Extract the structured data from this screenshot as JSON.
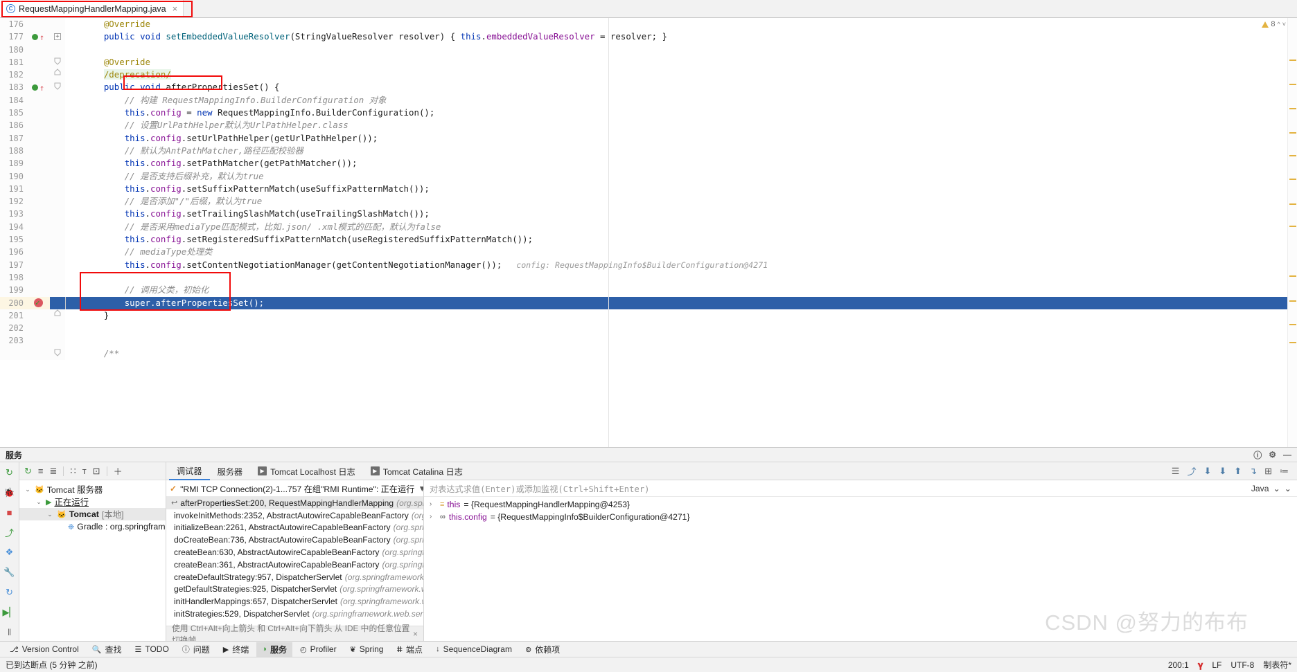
{
  "editor_tab": {
    "filename": "RequestMappingHandlerMapping.java",
    "icon": "java-class-icon",
    "close": "×"
  },
  "inspections": {
    "warning_count": "8",
    "warning_icon": "warning-triangle-icon",
    "chevron": "∧"
  },
  "code": {
    "lines": [
      {
        "num": "176",
        "segments": [
          {
            "t": "    ",
            "c": "id"
          },
          {
            "t": "@Override",
            "c": "ann"
          }
        ]
      },
      {
        "num": "177",
        "segments": [
          {
            "t": "    ",
            "c": "id"
          },
          {
            "t": "public",
            "c": "kw"
          },
          {
            "t": " ",
            "c": "id"
          },
          {
            "t": "void",
            "c": "kw"
          },
          {
            "t": " ",
            "c": "id"
          },
          {
            "t": "setEmbeddedValueResolver",
            "c": "mth-blue"
          },
          {
            "t": "(StringValueResolver resolver) { ",
            "c": "id"
          },
          {
            "t": "this",
            "c": "kw"
          },
          {
            "t": ".",
            "c": "id"
          },
          {
            "t": "embeddedValueResolver",
            "c": "fld"
          },
          {
            "t": " = resolver; }",
            "c": "id"
          }
        ],
        "marker": "override-green",
        "fold": "plus"
      },
      {
        "num": "180",
        "segments": []
      },
      {
        "num": "181",
        "segments": [
          {
            "t": "    ",
            "c": "id"
          },
          {
            "t": "@Override",
            "c": "ann"
          }
        ],
        "fold": "fold-top"
      },
      {
        "num": "182",
        "segments": [
          {
            "t": "    ",
            "c": "id"
          },
          {
            "t": "/deprecation/",
            "c": "ann depr"
          }
        ],
        "fold": "fold-bot"
      },
      {
        "num": "183",
        "segments": [
          {
            "t": "    ",
            "c": "id"
          },
          {
            "t": "public",
            "c": "kw"
          },
          {
            "t": " ",
            "c": "id"
          },
          {
            "t": "void",
            "c": "kw"
          },
          {
            "t": " ",
            "c": "id"
          },
          {
            "t": "afterPropertiesSet",
            "c": "id"
          },
          {
            "t": "() {",
            "c": "id"
          }
        ],
        "marker": "override-green",
        "fold": "fold-top"
      },
      {
        "num": "184",
        "segments": [
          {
            "t": "        ",
            "c": "id"
          },
          {
            "t": "// 构建 RequestMappingInfo.BuilderConfiguration 对象",
            "c": "cmt"
          }
        ]
      },
      {
        "num": "185",
        "segments": [
          {
            "t": "        ",
            "c": "id"
          },
          {
            "t": "this",
            "c": "kw"
          },
          {
            "t": ".",
            "c": "id"
          },
          {
            "t": "config",
            "c": "fld"
          },
          {
            "t": " = ",
            "c": "id"
          },
          {
            "t": "new",
            "c": "kw"
          },
          {
            "t": " RequestMappingInfo.BuilderConfiguration();",
            "c": "id"
          }
        ]
      },
      {
        "num": "186",
        "segments": [
          {
            "t": "        ",
            "c": "id"
          },
          {
            "t": "// 设置UrlPathHelper默认为UrlPathHelper.class",
            "c": "cmt"
          }
        ]
      },
      {
        "num": "187",
        "segments": [
          {
            "t": "        ",
            "c": "id"
          },
          {
            "t": "this",
            "c": "kw"
          },
          {
            "t": ".",
            "c": "id"
          },
          {
            "t": "config",
            "c": "fld"
          },
          {
            "t": ".setUrlPathHelper(getUrlPathHelper());",
            "c": "id"
          }
        ]
      },
      {
        "num": "188",
        "segments": [
          {
            "t": "        ",
            "c": "id"
          },
          {
            "t": "// 默认为AntPathMatcher,路径匹配校验器",
            "c": "cmt"
          }
        ]
      },
      {
        "num": "189",
        "segments": [
          {
            "t": "        ",
            "c": "id"
          },
          {
            "t": "this",
            "c": "kw"
          },
          {
            "t": ".",
            "c": "id"
          },
          {
            "t": "config",
            "c": "fld"
          },
          {
            "t": ".setPathMatcher(getPathMatcher());",
            "c": "id"
          }
        ]
      },
      {
        "num": "190",
        "segments": [
          {
            "t": "        ",
            "c": "id"
          },
          {
            "t": "// 是否支持后缀补充，默认为true",
            "c": "cmt"
          }
        ]
      },
      {
        "num": "191",
        "segments": [
          {
            "t": "        ",
            "c": "id"
          },
          {
            "t": "this",
            "c": "kw"
          },
          {
            "t": ".",
            "c": "id"
          },
          {
            "t": "config",
            "c": "fld"
          },
          {
            "t": ".setSuffixPatternMatch(useSuffixPatternMatch());",
            "c": "id"
          }
        ]
      },
      {
        "num": "192",
        "segments": [
          {
            "t": "        ",
            "c": "id"
          },
          {
            "t": "// 是否添加\"/\"后缀，默认为true",
            "c": "cmt"
          }
        ]
      },
      {
        "num": "193",
        "segments": [
          {
            "t": "        ",
            "c": "id"
          },
          {
            "t": "this",
            "c": "kw"
          },
          {
            "t": ".",
            "c": "id"
          },
          {
            "t": "config",
            "c": "fld"
          },
          {
            "t": ".setTrailingSlashMatch(useTrailingSlashMatch());",
            "c": "id"
          }
        ]
      },
      {
        "num": "194",
        "segments": [
          {
            "t": "        ",
            "c": "id"
          },
          {
            "t": "// 是否采用mediaType匹配模式，比如.json/ .xml模式的匹配，默认为false",
            "c": "cmt"
          }
        ]
      },
      {
        "num": "195",
        "segments": [
          {
            "t": "        ",
            "c": "id"
          },
          {
            "t": "this",
            "c": "kw"
          },
          {
            "t": ".",
            "c": "id"
          },
          {
            "t": "config",
            "c": "fld"
          },
          {
            "t": ".setRegisteredSuffixPatternMatch(useRegisteredSuffixPatternMatch());",
            "c": "id"
          }
        ]
      },
      {
        "num": "196",
        "segments": [
          {
            "t": "        ",
            "c": "id"
          },
          {
            "t": "// mediaType处理类",
            "c": "cmt"
          }
        ]
      },
      {
        "num": "197",
        "segments": [
          {
            "t": "        ",
            "c": "id"
          },
          {
            "t": "this",
            "c": "kw"
          },
          {
            "t": ".",
            "c": "id"
          },
          {
            "t": "config",
            "c": "fld"
          },
          {
            "t": ".setContentNegotiationManager(getContentNegotiationManager());",
            "c": "id"
          },
          {
            "t": "   config: RequestMappingInfo$BuilderConfiguration@4271",
            "c": "hint"
          }
        ]
      },
      {
        "num": "198",
        "segments": []
      },
      {
        "num": "199",
        "segments": [
          {
            "t": "        ",
            "c": "id"
          },
          {
            "t": "// 调用父类，初始化",
            "c": "cmt"
          }
        ]
      },
      {
        "num": "200",
        "segments": [
          {
            "t": "        ",
            "c": "id"
          },
          {
            "t": "super",
            "c": "kw"
          },
          {
            "t": ".afterPropertiesSet();",
            "c": "id"
          }
        ],
        "highlight": true,
        "marker": "breakpoint-hit"
      },
      {
        "num": "201",
        "segments": [
          {
            "t": "    ",
            "c": "id"
          },
          {
            "t": "}",
            "c": "id"
          }
        ],
        "fold": "fold-bot"
      },
      {
        "num": "202",
        "segments": []
      },
      {
        "num": "203",
        "segments": []
      },
      {
        "num": "",
        "segments": [
          {
            "t": "    ",
            "c": "id"
          },
          {
            "t": "/**",
            "c": "cmt"
          }
        ],
        "fold": "fold-top"
      }
    ],
    "annotation_boxes": [
      {
        "name": "method-name-redbox"
      },
      {
        "name": "super-call-redbox"
      }
    ]
  },
  "services_panel": {
    "title": "服务",
    "settings_icon": "gear-icon",
    "help_icon": "help-icon",
    "minimize_icon": "minimize-icon",
    "left_rail": [
      {
        "name": "rerun-icon",
        "glyph": "↻",
        "color": "#3c9a3c"
      },
      {
        "name": "debug-icon",
        "glyph": "🐞",
        "color": "#3c9a3c"
      },
      {
        "name": "stop-icon",
        "glyph": "■",
        "color": "#d64949"
      },
      {
        "name": "deploy-icon",
        "glyph": "⤴",
        "color": "#3c9a3c"
      },
      {
        "name": "browse-icon",
        "glyph": "❖",
        "color": "#4a90d9"
      },
      {
        "name": "settings-icon",
        "glyph": "🔧",
        "color": "#5a5a5a"
      },
      {
        "name": "restart-icon",
        "glyph": "↻",
        "color": "#4a90d9"
      },
      {
        "name": "resume-icon",
        "glyph": "▶▏",
        "color": "#3c9a3c"
      },
      {
        "name": "pause-icon",
        "glyph": "‖",
        "color": "#6a6a6a"
      },
      {
        "name": "more-icon",
        "glyph": "»",
        "color": "#6a6a6a"
      }
    ],
    "tree_toolbar": [
      {
        "name": "refresh-icon",
        "glyph": "↻",
        "color": "#3c9a3c"
      },
      {
        "name": "expand-all-icon",
        "glyph": "≡"
      },
      {
        "name": "collapse-all-icon",
        "glyph": "≣"
      },
      {
        "name": "group-icon",
        "glyph": "∷"
      },
      {
        "name": "filter-icon",
        "glyph": "ᴛ"
      },
      {
        "name": "show-content-icon",
        "glyph": "⊡"
      },
      {
        "name": "add-icon",
        "glyph": "＋"
      }
    ],
    "tree": [
      {
        "label": "Tomcat 服务器",
        "icon": "tomcat-icon",
        "indent": 0,
        "twisty": "⌄",
        "bold": false
      },
      {
        "label": "正在运行",
        "icon": "run-play-icon",
        "indent": 1,
        "twisty": "⌄",
        "underline": true
      },
      {
        "label": "Tomcat",
        "suffix": "[本地]",
        "icon": "tomcat-icon",
        "indent": 2,
        "twisty": "⌄",
        "bold": true,
        "selected": true
      },
      {
        "label": "Gradle : org.springfram",
        "icon": "gradle-icon",
        "indent": 3,
        "twisty": "",
        "bold": false
      }
    ]
  },
  "debugger": {
    "tabs": [
      {
        "label": "调试器",
        "active": true,
        "icon": ""
      },
      {
        "label": "服务器",
        "active": false,
        "icon": ""
      },
      {
        "label": "Tomcat Localhost 日志",
        "active": false,
        "icon": "console-icon"
      },
      {
        "label": "Tomcat Catalina 日志",
        "active": false,
        "icon": "console-icon"
      }
    ],
    "toolbar_icons": [
      {
        "name": "layout-icon",
        "glyph": "☰"
      },
      {
        "name": "step-over-icon",
        "glyph": "⤴"
      },
      {
        "name": "step-into-icon",
        "glyph": "⬇"
      },
      {
        "name": "force-step-into-icon",
        "glyph": "⬇"
      },
      {
        "name": "step-out-icon",
        "glyph": "⬆"
      },
      {
        "name": "run-to-cursor-icon",
        "glyph": "↴"
      },
      {
        "name": "evaluate-icon",
        "glyph": "⊞"
      },
      {
        "name": "settings-icon",
        "glyph": "≔"
      }
    ],
    "thread": {
      "check_icon": "check-icon",
      "label": "\"RMI TCP Connection(2)-1...757 在组\"RMI Runtime\": 正在运行",
      "filter_icon": "filter-icon",
      "dropdown_icon": "chevron-down-icon"
    },
    "frames": [
      {
        "text": "afterPropertiesSet:200, RequestMappingHandlerMapping",
        "pkg": "(org.springfra",
        "current": true,
        "icon": "return-arrow-icon"
      },
      {
        "text": "invokeInitMethods:2352, AbstractAutowireCapableBeanFactory",
        "pkg": "(org.spri",
        "current": false
      },
      {
        "text": "initializeBean:2261, AbstractAutowireCapableBeanFactory",
        "pkg": "(org.springfra",
        "current": false
      },
      {
        "text": "doCreateBean:736, AbstractAutowireCapableBeanFactory",
        "pkg": "(org.springfra",
        "current": false
      },
      {
        "text": "createBean:630, AbstractAutowireCapableBeanFactory",
        "pkg": "(org.springframe",
        "current": false
      },
      {
        "text": "createBean:361, AbstractAutowireCapableBeanFactory",
        "pkg": "(org.springframe",
        "current": false
      },
      {
        "text": "createDefaultStrategy:957, DispatcherServlet",
        "pkg": "(org.springframework.web.",
        "current": false
      },
      {
        "text": "getDefaultStrategies:925, DispatcherServlet",
        "pkg": "(org.springframework.web.s",
        "current": false
      },
      {
        "text": "initHandlerMappings:657, DispatcherServlet",
        "pkg": "(org.springframework.web.",
        "current": false
      },
      {
        "text": "initStrategies:529, DispatcherServlet",
        "pkg": "(org.springframework.web.servlet)",
        "current": false
      }
    ],
    "frames_hint": "使用 Ctrl+Alt+向上箭头 和 Ctrl+Alt+向下箭头 从 IDE 中的任意位置切换帧",
    "frames_hint_close": "×",
    "watch": {
      "placeholder": "对表达式求值(Enter)或添加监视(Ctrl+Shift+Enter)",
      "language": "Java",
      "lang_chevron": "⌄",
      "settings_chevron": "⌄"
    },
    "variables": [
      {
        "twisty": "›",
        "icon": "object-icon",
        "name": "this",
        "value": "= {RequestMappingHandlerMapping@4253}"
      },
      {
        "twisty": "›",
        "icon": "field-link-icon",
        "name": "this.config",
        "value": "= {RequestMappingInfo$BuilderConfiguration@4271}"
      }
    ]
  },
  "bottom_toolbar": [
    {
      "label": "Version Control",
      "icon": "branch-icon",
      "active": false
    },
    {
      "label": "查找",
      "icon": "search-icon",
      "active": false
    },
    {
      "label": "TODO",
      "icon": "todo-icon",
      "active": false
    },
    {
      "label": "问题",
      "icon": "problems-icon",
      "active": false
    },
    {
      "label": "终端",
      "icon": "terminal-icon",
      "active": false
    },
    {
      "label": "服务",
      "icon": "services-icon",
      "active": true
    },
    {
      "label": "Profiler",
      "icon": "profiler-icon",
      "active": false
    },
    {
      "label": "Spring",
      "icon": "spring-leaf-icon",
      "active": false
    },
    {
      "label": "端点",
      "icon": "endpoints-icon",
      "active": false
    },
    {
      "label": "SequenceDiagram",
      "icon": "sequence-icon",
      "active": false
    },
    {
      "label": "依赖项",
      "icon": "dependencies-icon",
      "active": false
    }
  ],
  "status_bar": {
    "message": "已到达断点 (5 分钟 之前)",
    "caret": "200:1",
    "git_branch_icon": "git-branch-icon",
    "line_sep": "LF",
    "encoding": "UTF-8",
    "indent": "制表符*"
  },
  "watermark": "CSDN @努力的布布",
  "colors": {
    "accent": "#3a7fd5",
    "highlight_row": "#2d5fa8",
    "redbox": "#f10b0b",
    "keyword": "#0033b3",
    "field": "#871094",
    "comment": "#8c8c8c",
    "annotation": "#9e880d"
  }
}
